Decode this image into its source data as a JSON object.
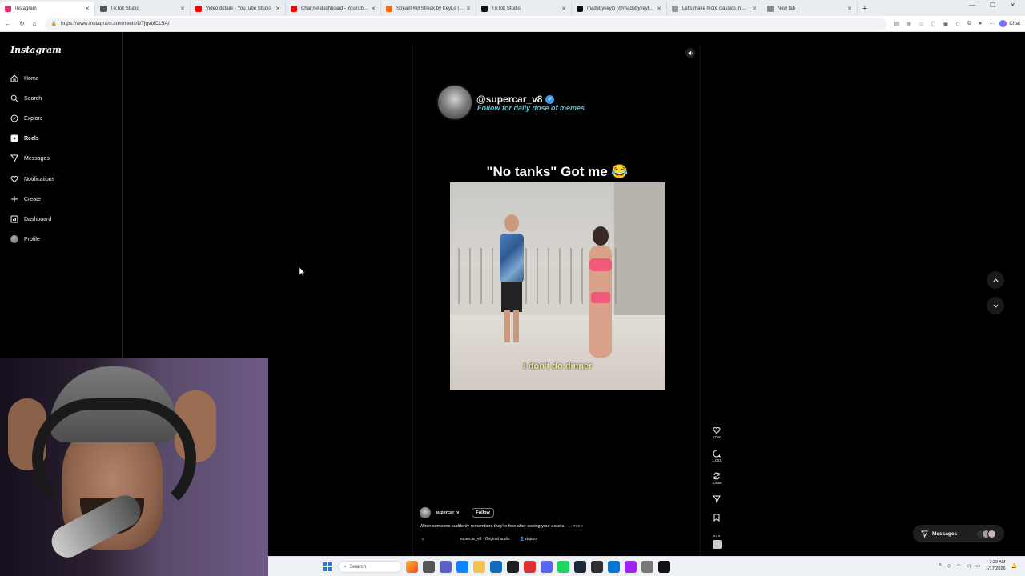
{
  "browser": {
    "tabs": [
      {
        "label": "Instagram",
        "color": "#e1306c",
        "active": true
      },
      {
        "label": "TikTok Studio",
        "color": "#555555",
        "active": false
      },
      {
        "label": "Video details - YouTube Studio",
        "color": "#ff0000",
        "active": false
      },
      {
        "label": "Channel dashboard - YouTube Stu",
        "color": "#ff0000",
        "active": false
      },
      {
        "label": "Stream Kill Streak by KeyLo | Liste",
        "color": "#ff6a00",
        "active": false
      },
      {
        "label": "TikTok Studio",
        "color": "#111111",
        "active": false
      },
      {
        "label": "madebykeylo (@madebykeylomu",
        "color": "#111111",
        "active": false
      },
      {
        "label": "Let's make more classics in 10 mi",
        "color": "#999999",
        "active": false
      },
      {
        "label": "New tab",
        "color": "#888888",
        "active": false
      }
    ],
    "url": "https://www.instagram.com/reels/DTjgvbiCL5A/",
    "chat_label": "Chat"
  },
  "sidebar": {
    "logo": "Instagram",
    "items": [
      {
        "label": "Home",
        "icon": "home-icon"
      },
      {
        "label": "Search",
        "icon": "search-icon"
      },
      {
        "label": "Explore",
        "icon": "compass-icon"
      },
      {
        "label": "Reels",
        "icon": "reels-icon",
        "active": true
      },
      {
        "label": "Messages",
        "icon": "send-icon"
      },
      {
        "label": "Notifications",
        "icon": "heart-icon"
      },
      {
        "label": "Create",
        "icon": "plus-icon"
      },
      {
        "label": "Dashboard",
        "icon": "dashboard-icon"
      },
      {
        "label": "Profile",
        "icon": "avatar"
      }
    ]
  },
  "reel": {
    "poster_handle": "@supercar_v8",
    "poster_tagline": "Follow for daily dose of memes",
    "caption_top": "\"No tanks\" Got me 😂",
    "video_subtitle": "I don't do dinner",
    "counts": {
      "likes": "171K",
      "comments": "1,001",
      "reposts": "4,536"
    },
    "username": "supercar_v",
    "follow_label": "Follow",
    "description": "When someone suddenly remembers they're free after seeing your assets.",
    "more_label": "... more",
    "audio": "supercar_v8 · Original audio",
    "tagged_user": "atajoro"
  },
  "messages_pill": {
    "label": "Messages"
  },
  "taskbar": {
    "search_placeholder": "Search",
    "time": "7:29 AM",
    "date": "1/17/2026"
  }
}
